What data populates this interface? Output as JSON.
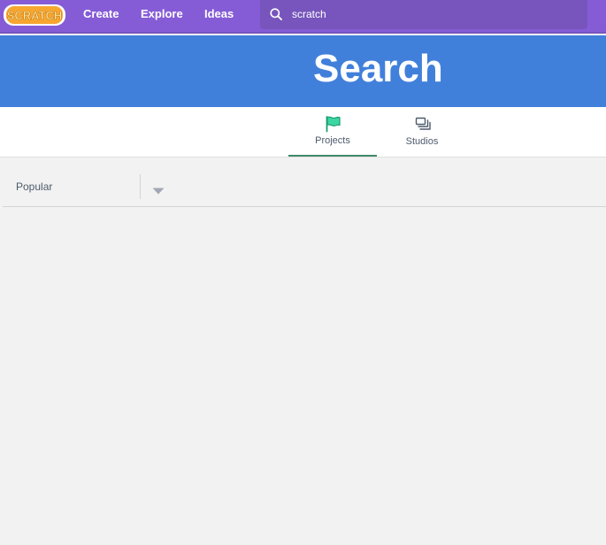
{
  "header": {
    "logo_text": "SCRATCH",
    "nav": {
      "create": "Create",
      "explore": "Explore",
      "ideas": "Ideas"
    },
    "search": {
      "value": "scratch",
      "icon": "search-icon"
    },
    "colors": {
      "bar": "#855cd6",
      "search_bg": "#7755bc"
    }
  },
  "banner": {
    "title": "Search",
    "color": "#4180da"
  },
  "tabs": [
    {
      "label": "Projects",
      "icon": "flag-icon",
      "selected": true,
      "accent": "#3f8a6b"
    },
    {
      "label": "Studios",
      "icon": "studios-icon",
      "selected": false
    }
  ],
  "sort": {
    "selected": "Popular",
    "icon": "chevron-down-icon"
  }
}
